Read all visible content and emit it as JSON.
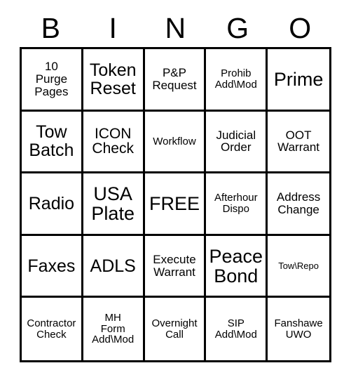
{
  "card": {
    "header_letters": [
      "B",
      "I",
      "N",
      "G",
      "O"
    ],
    "free_space_label": "FREE",
    "colors": {
      "border": "#000000",
      "background": "#ffffff",
      "text": "#000000"
    },
    "rows": [
      [
        {
          "label": "10\nPurge\nPages",
          "size": "sm"
        },
        {
          "label": "Token\nReset",
          "size": "lg"
        },
        {
          "label": "P&P\nRequest",
          "size": "sm"
        },
        {
          "label": "Prohib\nAdd\\Mod",
          "size": "xs"
        },
        {
          "label": "Prime",
          "size": "xl"
        }
      ],
      [
        {
          "label": "Tow\nBatch",
          "size": "lg"
        },
        {
          "label": "ICON\nCheck",
          "size": "md"
        },
        {
          "label": "Workflow",
          "size": "xs"
        },
        {
          "label": "Judicial\nOrder",
          "size": "sm"
        },
        {
          "label": "OOT\nWarrant",
          "size": "sm"
        }
      ],
      [
        {
          "label": "Radio",
          "size": "lg"
        },
        {
          "label": "USA\nPlate",
          "size": "xl"
        },
        {
          "label": "FREE",
          "size": "xl"
        },
        {
          "label": "Afterhour\nDispo",
          "size": "xs"
        },
        {
          "label": "Address\nChange",
          "size": "sm"
        }
      ],
      [
        {
          "label": "Faxes",
          "size": "lg"
        },
        {
          "label": "ADLS",
          "size": "lg"
        },
        {
          "label": "Execute\nWarrant",
          "size": "sm"
        },
        {
          "label": "Peace\nBond",
          "size": "xl"
        },
        {
          "label": "Tow\\Repo",
          "size": "xxs"
        }
      ],
      [
        {
          "label": "Contractor\nCheck",
          "size": "xs"
        },
        {
          "label": "MH\nForm\nAdd\\Mod",
          "size": "xs"
        },
        {
          "label": "Overnight\nCall",
          "size": "xs"
        },
        {
          "label": "SIP\nAdd\\Mod",
          "size": "xs"
        },
        {
          "label": "Fanshawe\nUWO",
          "size": "xs"
        }
      ]
    ]
  }
}
